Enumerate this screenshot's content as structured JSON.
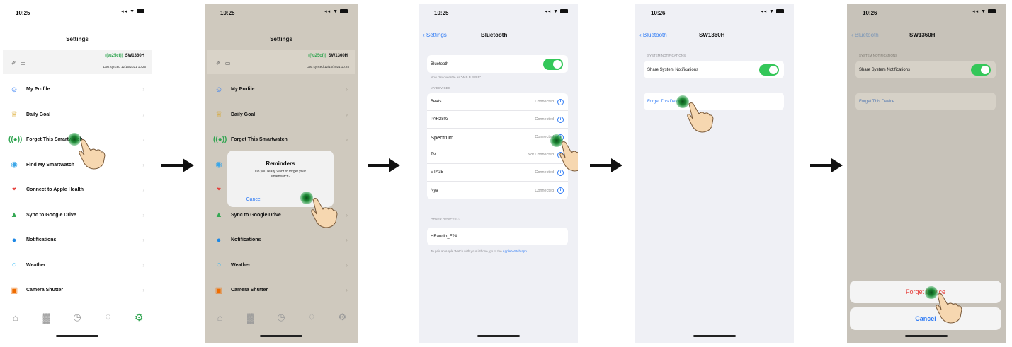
{
  "colors": {
    "accent": "#2f7bf5",
    "green": "#34c759",
    "destructive": "#e53935",
    "dim_overlay": "#cfc9be"
  },
  "status_bar": {
    "time": "10:25",
    "time_alt": "10:26",
    "signal": "◂◂ ▼"
  },
  "screen1": {
    "title": "Settings",
    "device": {
      "icons": "✐ ▭",
      "name": "SW1360H",
      "last_synced": "Last synced 12/10/2021 10:25"
    },
    "menu": [
      {
        "label": "My Profile",
        "icon": "user-icon",
        "glyph": "☺"
      },
      {
        "label": "Daily Goal",
        "icon": "trophy-icon",
        "glyph": "♕"
      },
      {
        "label": "Forget This Smartwatch",
        "icon": "watch-icon",
        "glyph": "((●))"
      },
      {
        "label": "Find My Smartwatch",
        "icon": "find-icon",
        "glyph": "◉"
      },
      {
        "label": "Connect to Apple Health",
        "icon": "health-icon",
        "glyph": "❤"
      },
      {
        "label": "Sync to Google Drive",
        "icon": "drive-icon",
        "glyph": "▲"
      },
      {
        "label": "Notifications",
        "icon": "notification-icon",
        "glyph": "●"
      },
      {
        "label": "Weather",
        "icon": "weather-icon",
        "glyph": "○"
      },
      {
        "label": "Camera Shutter",
        "icon": "camera-icon",
        "glyph": "▣"
      }
    ],
    "tabs": [
      {
        "icon": "home-icon",
        "glyph": "⌂"
      },
      {
        "icon": "stats-icon",
        "glyph": "▓"
      },
      {
        "icon": "timer-icon",
        "glyph": "◷"
      },
      {
        "icon": "bell-icon",
        "glyph": "♢"
      },
      {
        "icon": "settings-icon",
        "glyph": "⚙"
      }
    ]
  },
  "screen2": {
    "dialog": {
      "title": "Reminders",
      "message": "Do you really want to forget your smartwatch?",
      "cancel": "Cancel",
      "confirm": ""
    }
  },
  "screen3": {
    "back": "Settings",
    "title": "Bluetooth",
    "bluetooth_label": "Bluetooth",
    "discoverable_note": "Now discoverable as “W.B.B.B.B.B”.",
    "my_devices_label": "MY DEVICES",
    "devices": [
      {
        "name": "Beats",
        "status": "Connected"
      },
      {
        "name": "PAR2803",
        "status": "Connected"
      },
      {
        "name": "Spectrum",
        "status": "Connected"
      },
      {
        "name": "TV",
        "status": "Not Connected"
      },
      {
        "name": "VTA35",
        "status": "Connected"
      },
      {
        "name": "Nya",
        "status": "Connected"
      }
    ],
    "other_devices_label": "OTHER DEVICES",
    "other_devices": [
      {
        "name": "HRaudio_E2A"
      }
    ],
    "watch_note": "To pair an Apple Watch with your iPhone, go to the",
    "watch_link": "Apple Watch app."
  },
  "screen4": {
    "back": "Bluetooth",
    "title": "SW1360H",
    "section_label": "SYSTEM NOTIFICATIONS",
    "share_label": "Share System Notifications",
    "forget_label": "Forget This Device"
  },
  "screen5": {
    "back": "Bluetooth",
    "title": "SW1360H",
    "section_label": "SYSTEM NOTIFICATIONS",
    "share_label": "Share System Notifications",
    "forget_label": "Forget This Device",
    "sheet_forget": "Forget Device",
    "sheet_cancel": "Cancel"
  }
}
